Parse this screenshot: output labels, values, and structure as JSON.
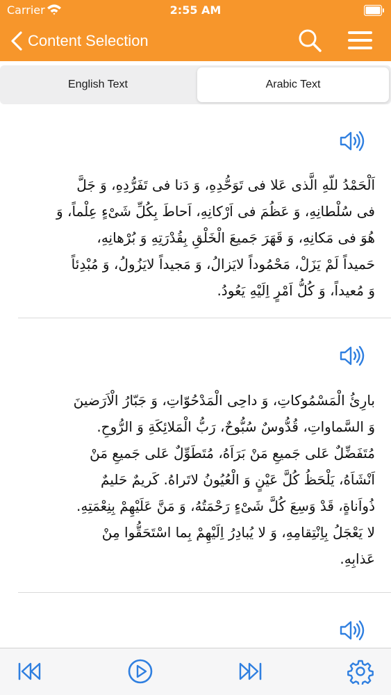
{
  "status_bar": {
    "carrier": "Carrier",
    "time": "2:55 AM"
  },
  "nav": {
    "back_label": "Content Selection",
    "search_icon": "search-icon",
    "menu_icon": "menu-icon"
  },
  "segments": [
    {
      "label": "English Text",
      "selected": false
    },
    {
      "label": "Arabic Text",
      "selected": true
    }
  ],
  "sections": [
    {
      "lines": [
        "اَلْحَمْدُ للّهِ الَّذى عَلا فى تَوَحُّدِهِ، وَ دَنا فى تَفَرُّدِهِ، وَ جَلَّ",
        "فى سُلْطانِهِ، وَ عَظُمَ فى اَرْكانِهِ، اَحاطَ بِكُلِّ شَىْءٍ عِلْماً، وَ",
        "هُوَ فى مَكانِهِ، وَ قَهَرَ جَميعَ الْخَلْقِ بِقُدْرَتِهِ وَ بُرْهانِهِ،",
        "حَميداً لَمْ يَزَلْ، مَحْمُوداً لايَزالُ، وَ مَجيداً لايَزُولُ، وَ مُبْدِئاً",
        "وَ مُعيداً، وَ كُلُّ اَمْرٍ اِلَيْهِ يَعُودُ."
      ]
    },
    {
      "lines": [
        "بارِئُ الْمَسْمُوكاتِ، وَ داحِى الْمَدْحُوّاتِ، وَ جَبّارُ الْاَرَضينَ",
        "وَ السَّماواتِ، قُدُّوسٌ سُبُّوحٌ، رَبُّ الْمَلائِكَةِ وَ الرُّوحِ.",
        "مُتَفَضِّلٌ عَلى جَميعِ مَنْ بَرَاَهُ، مُتَطَوِّلٌ عَلى جَميعِ مَنْ",
        "اَنْشَاَهُ، يَلْحَظُ كُلَّ عَيْنٍ وَ الْعُيُونُ لاتَراهُ. كَريمٌ حَليمٌ",
        "ذُواَناةٍ، قَدْ وَسِعَ كُلَّ شَىْءٍ رَحْمَتُهُ، وَ مَنَّ عَلَيْهِمْ بِنِعْمَتِهِ.",
        "لا يَعْجَلُ بِاِنْتِقامِهِ، وَ لا يُبادِرُ اِلَيْهِمْ بِما اسْتَحَقُّوا مِنْ",
        "عَذابِهِ."
      ]
    }
  ],
  "icons": {
    "speaker": "speaker-icon",
    "rewind": "rewind-icon",
    "play": "play-icon",
    "fast_forward": "fast-forward-icon",
    "settings": "gear-icon"
  },
  "colors": {
    "accent": "#f7962b",
    "icon_blue": "#2f7fe0"
  }
}
